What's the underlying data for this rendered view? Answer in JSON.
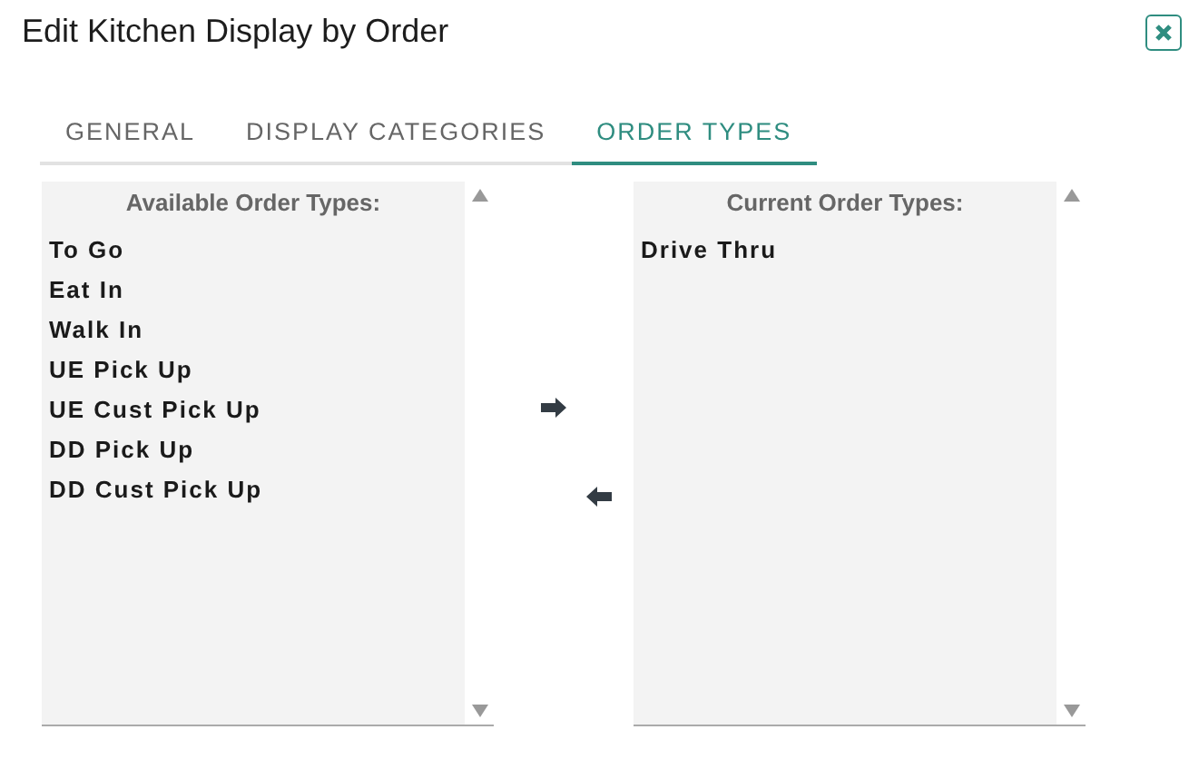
{
  "dialog": {
    "title": "Edit Kitchen Display by Order"
  },
  "tabs": [
    {
      "label": "GENERAL",
      "selected": false
    },
    {
      "label": "DISPLAY CATEGORIES",
      "selected": false
    },
    {
      "label": "ORDER TYPES",
      "selected": true
    }
  ],
  "available_list": {
    "heading": "Available Order Types:",
    "items": [
      "To Go",
      "Eat In",
      "Walk In",
      "UE Pick Up",
      "UE Cust Pick Up",
      "DD Pick Up",
      "DD Cust Pick Up"
    ]
  },
  "current_list": {
    "heading": "Current Order Types:",
    "items": [
      "Drive Thru"
    ]
  }
}
